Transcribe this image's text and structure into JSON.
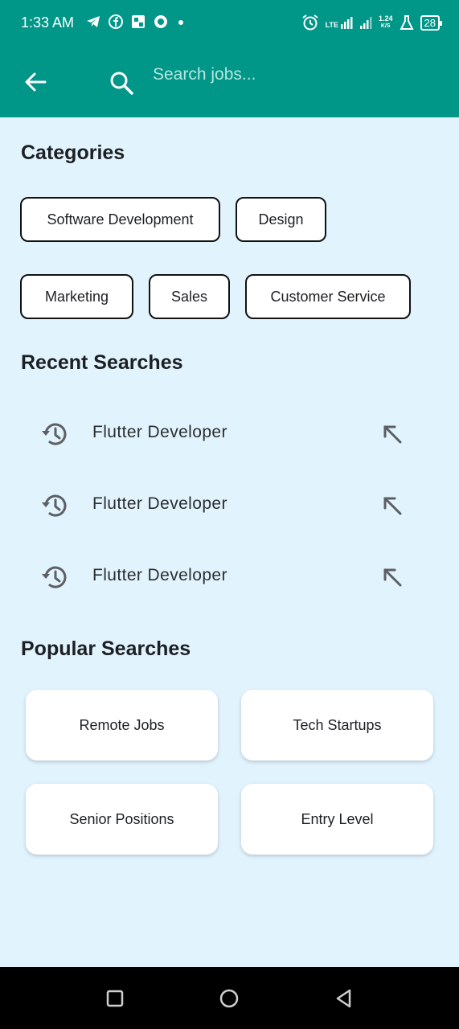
{
  "status_bar": {
    "time": "1:33 AM",
    "left_icons": [
      "telegram-icon",
      "facebook-icon",
      "news-icon",
      "app-icon",
      "dot-icon"
    ],
    "right_icons": [
      "alarm-icon",
      "lte-signal-icon",
      "signal-icon",
      "data-speed-icon",
      "lab-icon",
      "battery-icon"
    ],
    "lte_label": "LTE",
    "speed_value": "1.24",
    "speed_unit": "K/S",
    "battery": "28"
  },
  "app_bar": {
    "background": "#009688",
    "search_placeholder": "Search jobs..."
  },
  "categories": {
    "title": "Categories",
    "chips": [
      "Software Development",
      "Design",
      "Marketing",
      "Sales",
      "Customer Service"
    ]
  },
  "recent": {
    "title": "Recent Searches",
    "items": [
      "Flutter Developer",
      "Flutter Developer",
      "Flutter Developer"
    ]
  },
  "popular": {
    "title": "Popular Searches",
    "items": [
      "Remote Jobs",
      "Tech Startups",
      "Senior Positions",
      "Entry Level"
    ]
  },
  "nav_bar": {
    "buttons": [
      "recent-apps-icon",
      "home-icon",
      "back-nav-icon"
    ]
  },
  "colors": {
    "primary": "#009688",
    "background": "#e1f3fd",
    "text": "#1c1f23"
  }
}
